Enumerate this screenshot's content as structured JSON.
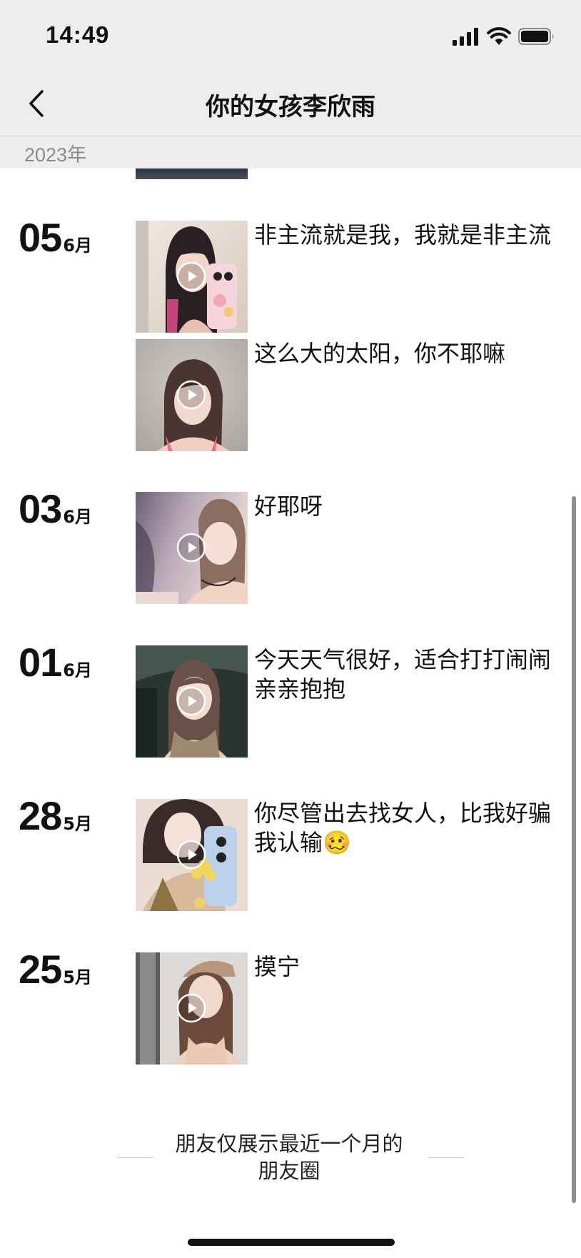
{
  "status_bar": {
    "time": "14:49",
    "icons": [
      "cellular-signal-icon",
      "wifi-icon",
      "battery-icon"
    ]
  },
  "nav": {
    "back_icon": "chevron-left-icon",
    "title": "你的女孩李欣雨"
  },
  "timeline": {
    "year": "2023年",
    "days": [
      {
        "day": "05",
        "month": "6月",
        "posts": [
          {
            "type": "video",
            "text": "非主流就是我，我就是非主流"
          },
          {
            "type": "video",
            "text": "这么大的太阳，你不耶嘛"
          }
        ]
      },
      {
        "day": "03",
        "month": "6月",
        "posts": [
          {
            "type": "video",
            "text": "好耶呀"
          }
        ]
      },
      {
        "day": "01",
        "month": "6月",
        "posts": [
          {
            "type": "video",
            "text": "今天天气很好，适合打打闹闹亲亲抱抱"
          }
        ]
      },
      {
        "day": "28",
        "month": "5月",
        "posts": [
          {
            "type": "video",
            "text": "你尽管出去找女人，比我好骗我认输🥴"
          }
        ]
      },
      {
        "day": "25",
        "month": "5月",
        "posts": [
          {
            "type": "video",
            "text": "摸宁"
          }
        ]
      }
    ]
  },
  "footer": {
    "line1": "朋友仅展示最近一个月的",
    "line2": "朋友圈"
  },
  "colors": {
    "header_bg": "#ededed",
    "page_bg": "#ffffff",
    "text": "#111111",
    "muted": "#8c8c8c"
  }
}
